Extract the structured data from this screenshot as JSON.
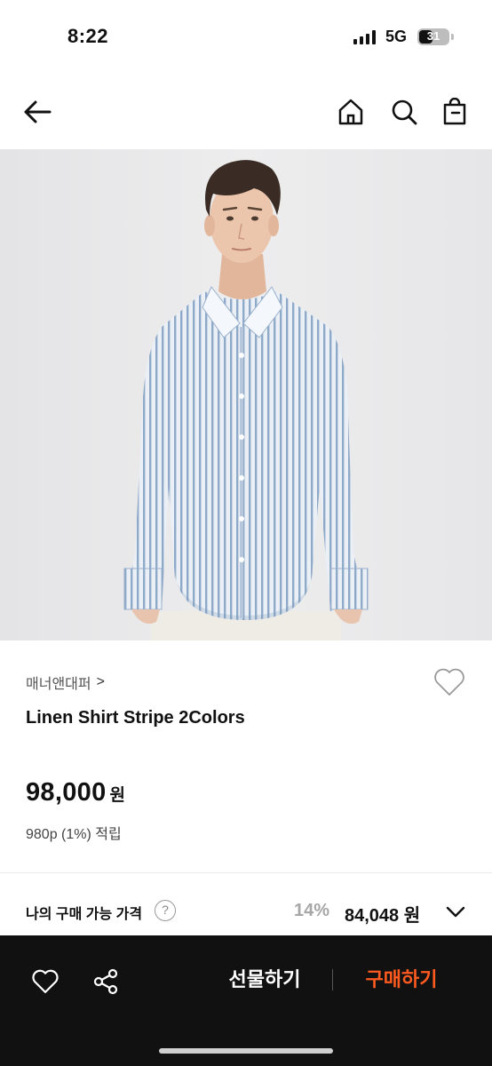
{
  "status_bar": {
    "time": "8:22",
    "network": "5G",
    "battery": "31"
  },
  "nav": {
    "back_icon": "arrow-left-icon",
    "home_icon": "home-icon",
    "search_icon": "search-icon",
    "cart_icon": "shopping-bag-icon"
  },
  "product": {
    "image_icon": "product-photo",
    "brand": "매너앤대퍼",
    "brand_chevron": ">",
    "name": "Linen Shirt Stripe 2Colors",
    "price": "98,000",
    "price_unit": "원",
    "points": "980p (1%) 적립"
  },
  "my_price": {
    "label": "나의 구매 가능 가격",
    "help": "?",
    "discount_rate": "14%",
    "price": "84,048 원"
  },
  "bottom_bar": {
    "gift_label": "선물하기",
    "buy_label": "구매하기"
  },
  "colors": {
    "accent": "#ff5a1f",
    "bottom_bar_bg": "#111111",
    "discount_gray": "#a7a7a7"
  }
}
